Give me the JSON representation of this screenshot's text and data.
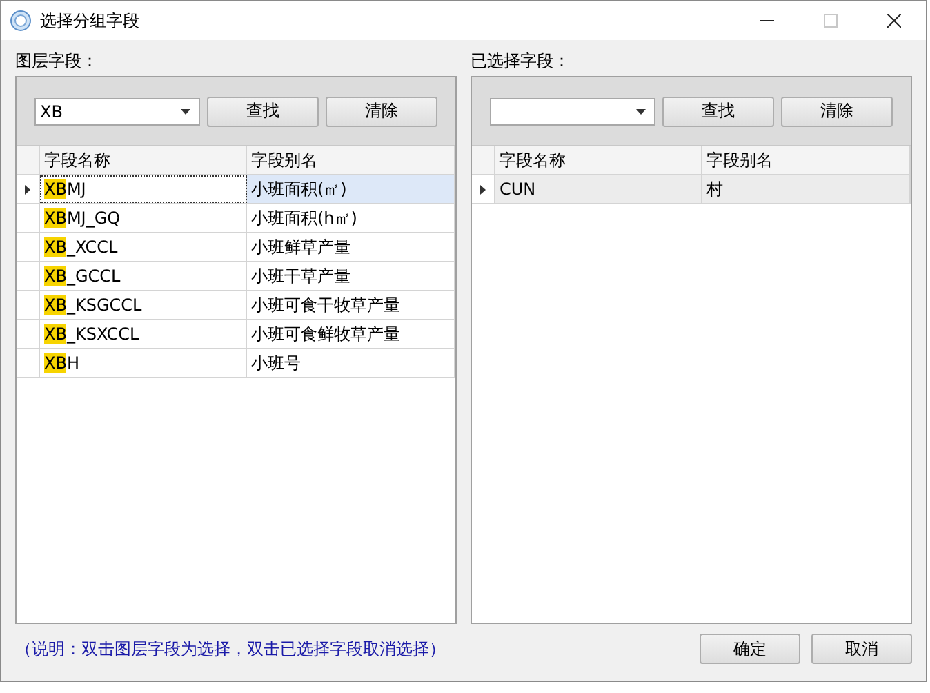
{
  "window": {
    "title": "选择分组字段"
  },
  "title_buttons": [
    {
      "kind": "minimize",
      "disabled": false
    },
    {
      "kind": "maximize",
      "disabled": true
    },
    {
      "kind": "close",
      "disabled": false
    }
  ],
  "panels": [
    {
      "label": "图层字段：",
      "search_value": "XB",
      "find_button": "查找",
      "clear_button": "清除",
      "columns": [
        "字段名称",
        "字段别名"
      ],
      "rows": [
        {
          "name_match": "XB",
          "name_rest": "MJ",
          "alias": "小班面积(㎡)",
          "selected": true
        },
        {
          "name_match": "XB",
          "name_rest": "MJ_GQ",
          "alias": "小班面积(h㎡)",
          "selected": false
        },
        {
          "name_match": "XB",
          "name_rest": "_XCCL",
          "alias": "小班鲜草产量",
          "selected": false
        },
        {
          "name_match": "XB",
          "name_rest": "_GCCL",
          "alias": "小班干草产量",
          "selected": false
        },
        {
          "name_match": "XB",
          "name_rest": "_KSGCCL",
          "alias": "小班可食干牧草产量",
          "selected": false
        },
        {
          "name_match": "XB",
          "name_rest": "_KSXCCL",
          "alias": "小班可食鲜牧草产量",
          "selected": false
        },
        {
          "name_match": "XB",
          "name_rest": "H",
          "alias": "小班号",
          "selected": false
        }
      ]
    },
    {
      "label": "已选择字段：",
      "find_button": "查找",
      "clear_button": "清除",
      "columns": [
        "字段名称",
        "字段别名"
      ],
      "rows": [
        {
          "name_rest": "CUN",
          "alias": "村",
          "selected": true
        }
      ]
    }
  ],
  "note": "（说明：双击图层字段为选择，双击已选择字段取消选择）",
  "buttons": [
    "确定",
    "取消"
  ]
}
